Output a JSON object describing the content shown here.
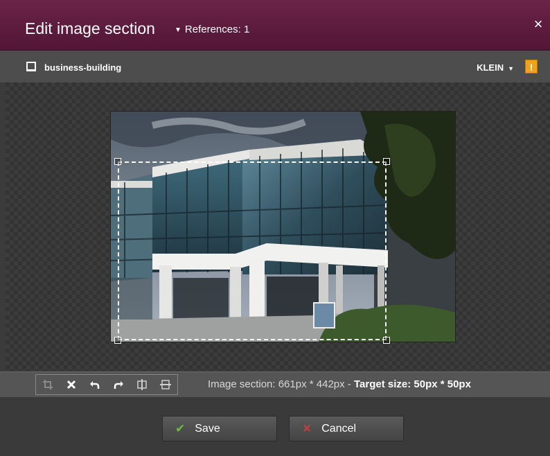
{
  "dialog": {
    "title": "Edit image section",
    "references_label": "References: 1",
    "close_glyph": "×"
  },
  "file": {
    "name": "business-building",
    "size_option": "KLEIN",
    "warning_glyph": "!"
  },
  "image": {
    "subject": "modern office building with glass facade and white columns"
  },
  "toolbar": {
    "tools": [
      "crop-icon",
      "clear-icon",
      "undo-icon",
      "redo-icon",
      "fit-width-icon",
      "fit-height-icon"
    ],
    "section_text": "Image section: 661px * 442px - ",
    "target_text": "Target size: 50px * 50px"
  },
  "buttons": {
    "save_label": "Save",
    "cancel_label": "Cancel"
  },
  "colors": {
    "titlebar": "#5e1a3e",
    "warning": "#f0a21a",
    "save_icon": "#6cbf3a",
    "cancel_icon": "#e03a3a"
  }
}
